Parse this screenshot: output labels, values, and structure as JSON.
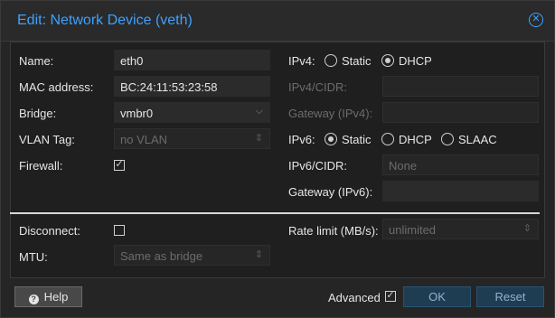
{
  "dialog": {
    "title": "Edit: Network Device (veth)"
  },
  "left": {
    "name": {
      "label": "Name:",
      "value": "eth0"
    },
    "mac": {
      "label": "MAC address:",
      "value": "BC:24:11:53:23:58"
    },
    "bridge": {
      "label": "Bridge:",
      "value": "vmbr0"
    },
    "vlan": {
      "label": "VLAN Tag:",
      "placeholder": "no VLAN"
    },
    "firewall": {
      "label": "Firewall:",
      "checked": true
    }
  },
  "right": {
    "ipv4": {
      "label": "IPv4:",
      "options": [
        "Static",
        "DHCP"
      ],
      "selected": "DHCP"
    },
    "ipv4_cidr": {
      "label": "IPv4/CIDR:"
    },
    "gateway4": {
      "label": "Gateway (IPv4):"
    },
    "ipv6": {
      "label": "IPv6:",
      "options": [
        "Static",
        "DHCP",
        "SLAAC"
      ],
      "selected": "Static"
    },
    "ipv6_cidr": {
      "label": "IPv6/CIDR:",
      "placeholder": "None"
    },
    "gateway6": {
      "label": "Gateway (IPv6):"
    }
  },
  "advanced_section": {
    "disconnect": {
      "label": "Disconnect:",
      "checked": false
    },
    "mtu": {
      "label": "MTU:",
      "placeholder": "Same as bridge"
    },
    "rate_limit": {
      "label": "Rate limit (MB/s):",
      "placeholder": "unlimited"
    }
  },
  "footer": {
    "help": "Help",
    "advanced": "Advanced",
    "advanced_checked": true,
    "ok": "OK",
    "reset": "Reset"
  },
  "colors": {
    "accent": "#3ea1ff",
    "primary_button": "#1e3d52"
  }
}
